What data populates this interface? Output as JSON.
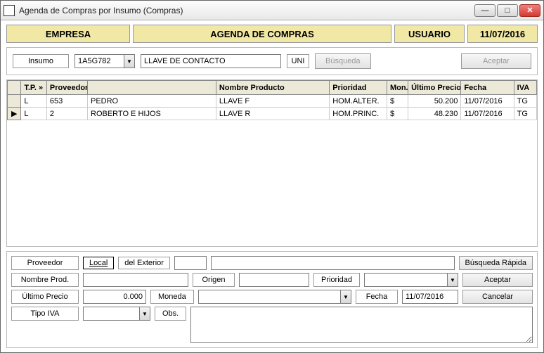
{
  "window": {
    "title": "Agenda de Compras por Insumo (Compras)"
  },
  "header": {
    "empresa": "EMPRESA",
    "agenda": "AGENDA DE COMPRAS",
    "usuario": "USUARIO",
    "fecha": "11/07/2016"
  },
  "search": {
    "insumo_label": "Insumo",
    "insumo_code": "1A5G782",
    "insumo_desc": "LLAVE DE CONTACTO",
    "unidad": "UNI",
    "busqueda_label": "Búsqueda",
    "aceptar_label": "Aceptar"
  },
  "grid": {
    "headers": {
      "tp": "T.P. »",
      "proveedor": "Proveedor",
      "proveedor_nombre": "",
      "nombre_producto": "Nombre Producto",
      "prioridad": "Prioridad",
      "mon": "Mon.",
      "ultimo_precio": "Último Precio",
      "fecha": "Fecha",
      "iva": "IVA"
    },
    "rows": [
      {
        "sel": "",
        "tp": "L",
        "prov_id": "653",
        "prov_nom": "PEDRO",
        "nom_prod": "LLAVE F",
        "prioridad": "HOM.ALTER.",
        "mon": "$",
        "ult_precio": "50.200",
        "fecha": "11/07/2016",
        "iva": "TG"
      },
      {
        "sel": "▶",
        "tp": "L",
        "prov_id": "2",
        "prov_nom": "ROBERTO E HIJOS",
        "nom_prod": "LLAVE R",
        "prioridad": "HOM.PRINC.",
        "mon": "$",
        "ult_precio": "48.230",
        "fecha": "11/07/2016",
        "iva": "TG"
      }
    ]
  },
  "form": {
    "proveedor_label": "Proveedor",
    "local_btn": "Local",
    "exterior_btn": "del Exterior",
    "busqueda_rapida": "Búsqueda Rápida",
    "nombre_prod_label": "Nombre Prod.",
    "origen_label": "Origen",
    "prioridad_label": "Prioridad",
    "aceptar": "Aceptar",
    "ultimo_precio_label": "Último Precio",
    "ultimo_precio_val": "0.000",
    "moneda_label": "Moneda",
    "fecha_label": "Fecha",
    "fecha_val": "11/07/2016",
    "cancelar": "Cancelar",
    "tipo_iva_label": "Tipo IVA",
    "obs_label": "Obs."
  }
}
